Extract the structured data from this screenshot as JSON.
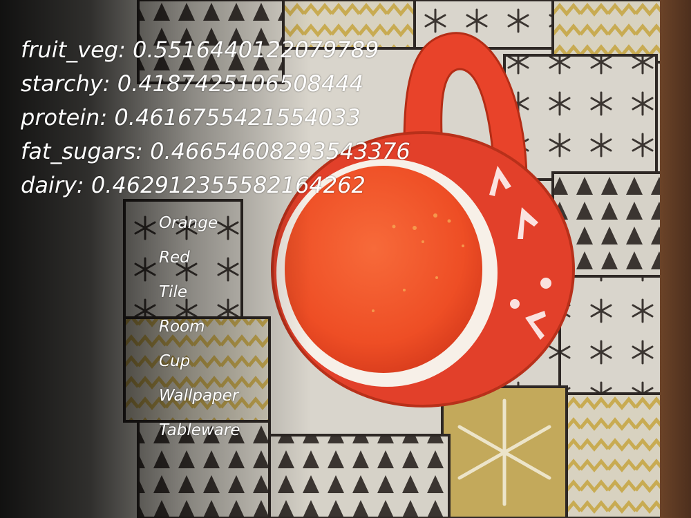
{
  "scores": [
    {
      "label": "fruit_veg",
      "value": "0.5516440122079789"
    },
    {
      "label": "starchy",
      "value": "0.4187425106508444"
    },
    {
      "label": "protein",
      "value": "0.4616755421554033"
    },
    {
      "label": "fat_sugars",
      "value": "0.46654608293543376"
    },
    {
      "label": "dairy",
      "value": "0.462912355582164262"
    }
  ],
  "tags": [
    "Orange",
    "Red",
    "Tile",
    "Room",
    "Cup",
    "Wallpaper",
    "Tableware"
  ],
  "colors": {
    "mug": "#e8432a",
    "soup": "#f0542b",
    "tablecloth_light": "#dcd8cf",
    "pattern_dark": "#3b3531",
    "pattern_gold": "#c8ab52",
    "wood": "#5c3a24"
  }
}
